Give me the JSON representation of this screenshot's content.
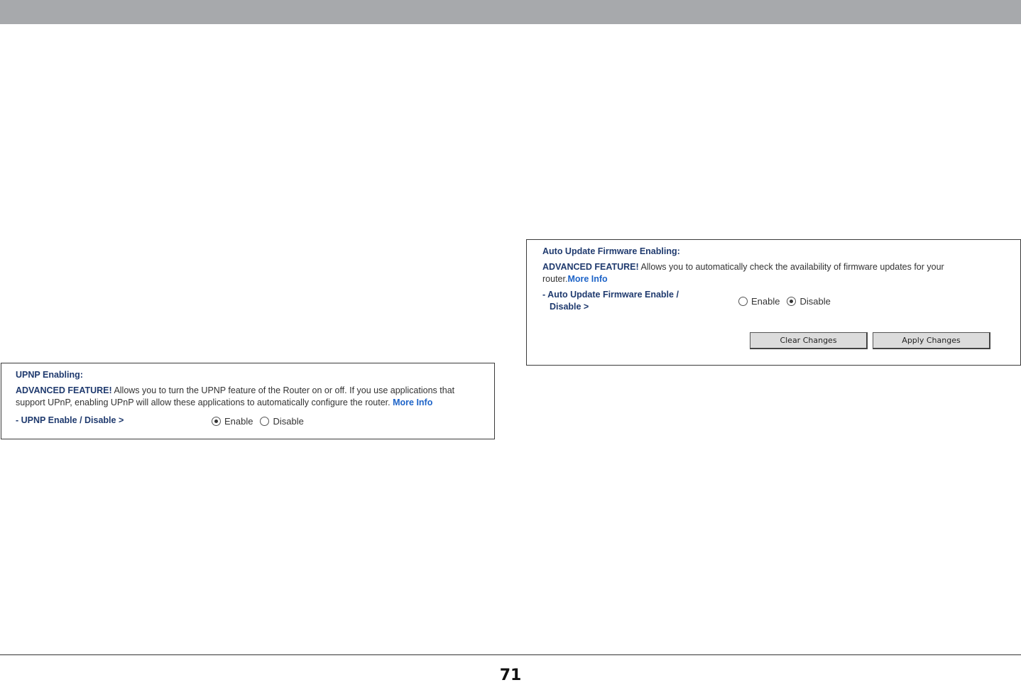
{
  "upnp": {
    "title": "UPNP Enabling:",
    "adv_label": "ADVANCED FEATURE!",
    "description": " Allows you to turn the UPNP feature of the Router on or off. If you use applications that support UPnP, enabling UPnP will allow these applications to automatically configure the router. ",
    "more_info": "More Info",
    "field_label": "- UPNP Enable / Disable >",
    "options": [
      {
        "label": "Enable",
        "checked": true
      },
      {
        "label": "Disable",
        "checked": false
      }
    ]
  },
  "firmware": {
    "title": "Auto Update Firmware Enabling:",
    "adv_label": "ADVANCED FEATURE!",
    "description": " Allows you to automatically check the availability of firmware updates for your router.",
    "more_info": "More Info",
    "field_label_line1": "- Auto Update Firmware Enable /",
    "field_label_line2": "Disable >",
    "options": [
      {
        "label": "Enable",
        "checked": false
      },
      {
        "label": "Disable",
        "checked": true
      }
    ],
    "buttons": {
      "clear": "Clear Changes",
      "apply": "Apply Changes"
    }
  },
  "footer": {
    "page_number": "71"
  },
  "colors": {
    "top_band": "#a7a9ac",
    "heading_blue": "#1f3a6e",
    "link_blue": "#1e64c8"
  }
}
